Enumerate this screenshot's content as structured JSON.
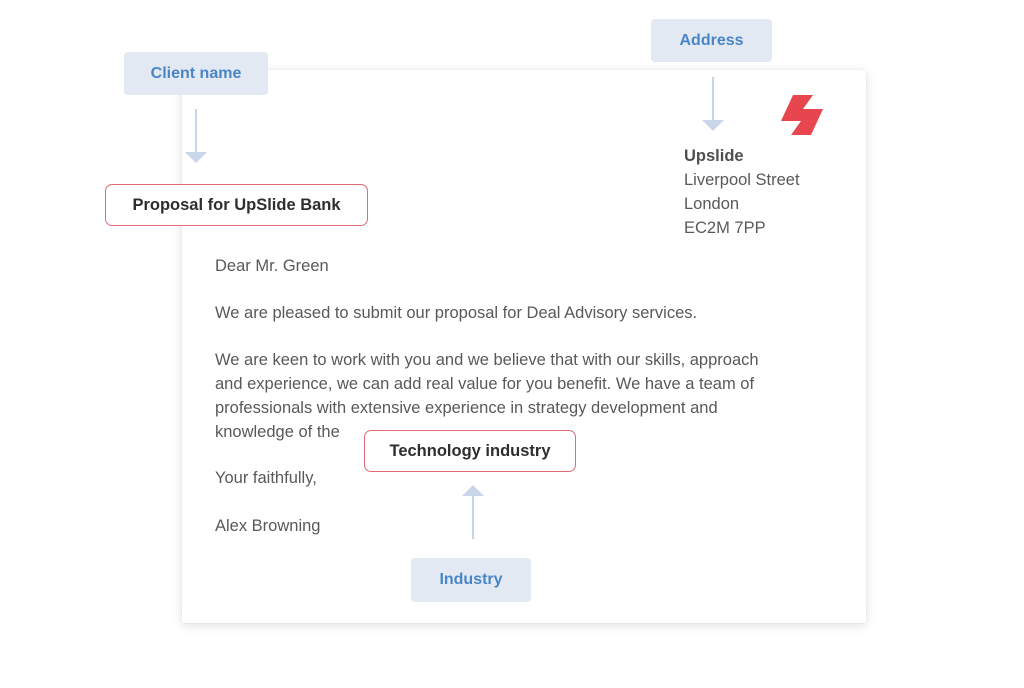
{
  "labels": {
    "client_name": "Client name",
    "address": "Address",
    "industry": "Industry"
  },
  "fields": {
    "proposal_title": "Proposal for UpSlide Bank",
    "industry_value": "Technology industry"
  },
  "address": {
    "company": "Upslide",
    "street": "Liverpool Street",
    "city": "London",
    "postcode": "EC2M 7PP"
  },
  "letter": {
    "greeting": "Dear Mr. Green",
    "paragraph1": "We are pleased to submit our proposal for Deal Advisory services.",
    "paragraph2_lines": [
      "We are keen to work with you and we believe that with our skills, approach",
      "and experience, we can add real value for you benefit. We have a team of",
      "professionals with extensive experience in strategy development and",
      "knowledge of the"
    ],
    "closing": "Your faithfully,",
    "signature": "Alex Browning"
  },
  "icons": {
    "logo": "upslide-logo-icon",
    "arrow_down": "arrow-down-icon",
    "arrow_up": "arrow-up-icon"
  },
  "colors": {
    "pill_bg": "#e3e9f3",
    "pill_text": "#4a86c5",
    "field_border": "#e06b74",
    "logo_red": "#e8464f",
    "body_text": "#595959"
  }
}
